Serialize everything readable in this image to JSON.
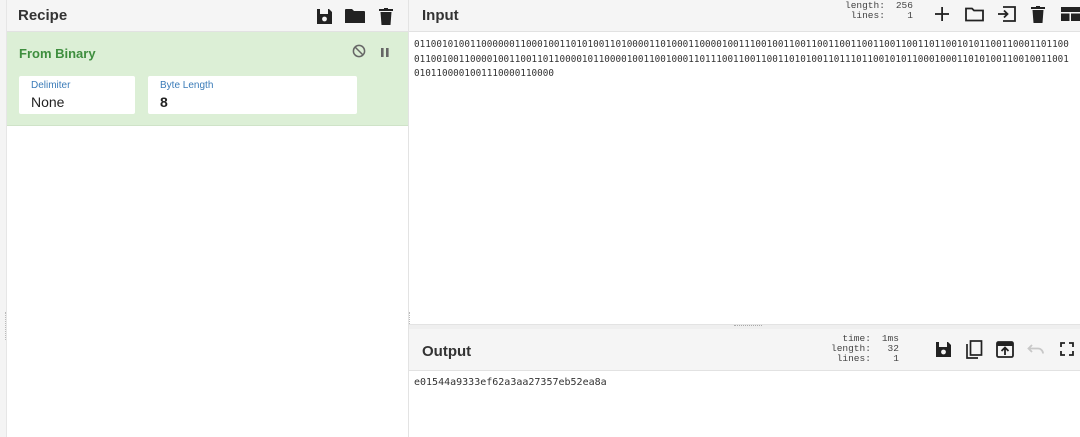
{
  "recipe": {
    "title": "Recipe",
    "header_icons": [
      "save-icon",
      "folder-icon",
      "trash-icon"
    ],
    "operation": {
      "title": "From Binary",
      "controls": [
        "disable-icon",
        "pause-icon"
      ],
      "delimiter_label": "Delimiter",
      "delimiter_value": "None",
      "byte_length_label": "Byte Length",
      "byte_length_value": "8"
    }
  },
  "input": {
    "title": "Input",
    "length_label": "length:",
    "length_value": "256",
    "lines_label": "lines:",
    "lines_value": "1",
    "icons": [
      "add-icon",
      "open-folder-icon",
      "import-icon",
      "trash-icon",
      "layout-icon"
    ],
    "text": "0110010100110000001100010011010100110100001101000110000100111001001100110011001100110011001101100101011001100011011000110010011000010011001101100001011000010011001000110111001100110011010100110111011001010110001000110101001100100110010101100001001110000110000"
  },
  "output": {
    "title": "Output",
    "time_label": "time:",
    "time_value": "1ms",
    "length_label": "length:",
    "length_value": "32",
    "lines_label": "lines:",
    "lines_value": "1",
    "icons": [
      "save-icon",
      "copy-icon",
      "replace-input-icon",
      "undo-icon",
      "fullscreen-icon"
    ],
    "text": "e01544a9333ef62a3aa27357eb52ea8a"
  },
  "colors": {
    "operation_bg": "#dcefd6",
    "operation_title": "#3e8e3e",
    "field_label": "#3a7bb8",
    "header_bg": "#f5f5f5"
  }
}
